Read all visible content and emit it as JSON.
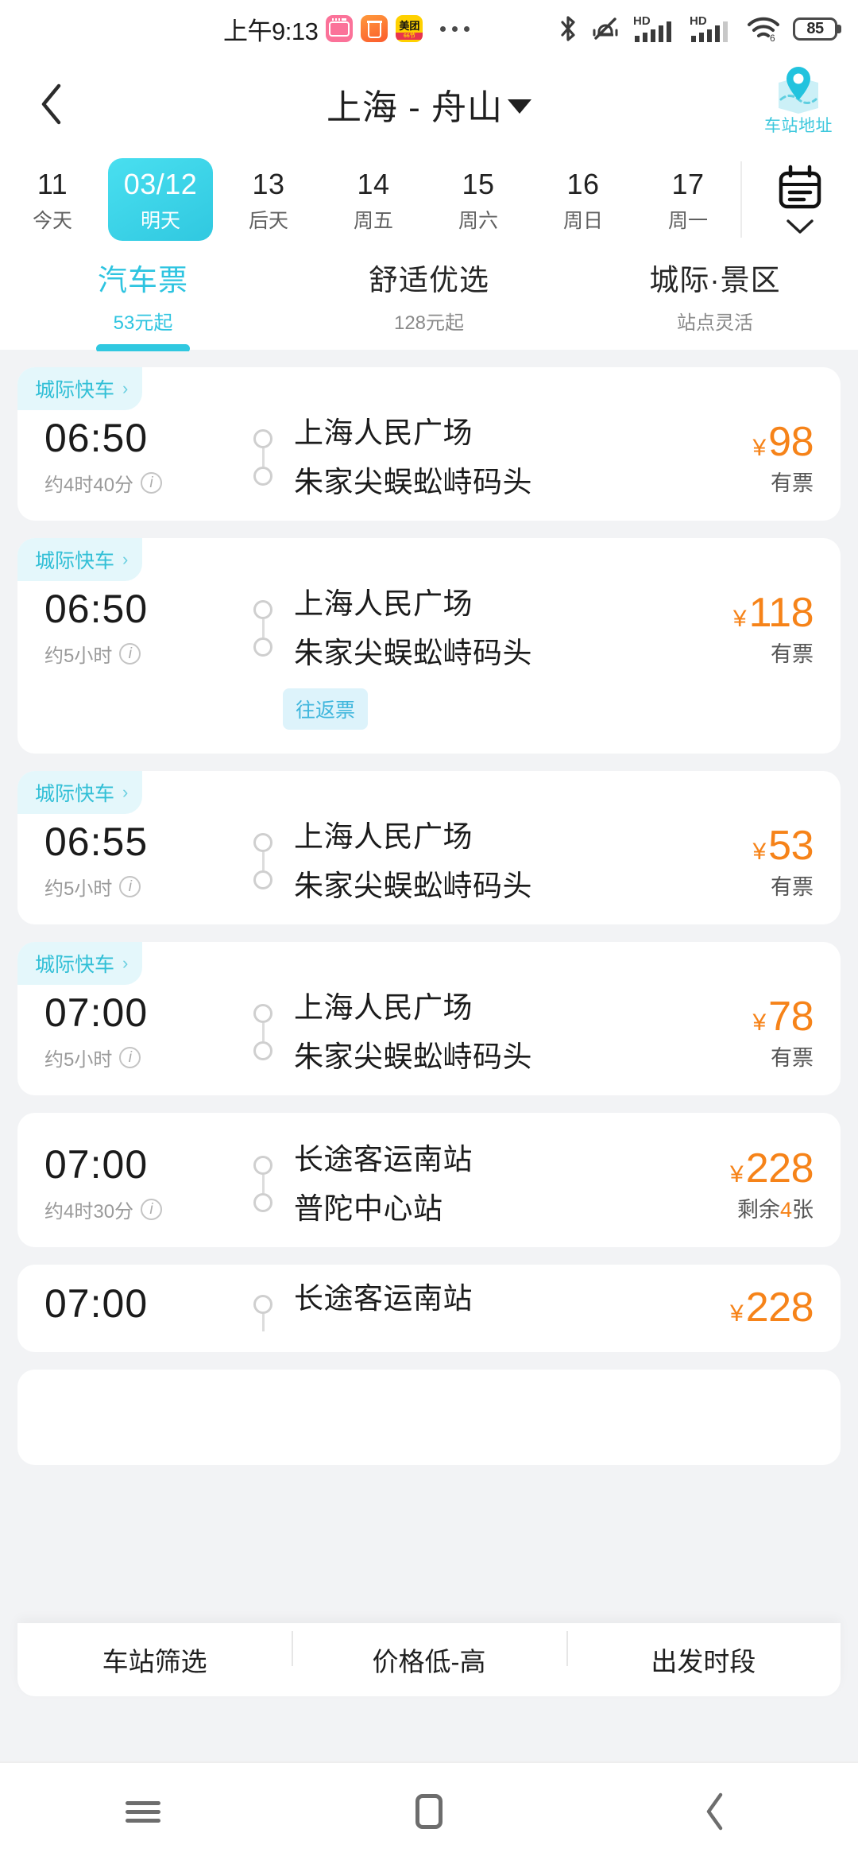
{
  "status_bar": {
    "time": "上午9:13",
    "app_icons": [
      "bilibili-icon",
      "trash-icon",
      "meituan-icon"
    ],
    "meituan_top": "美团",
    "meituan_bottom": "66节",
    "overflow": "more-apps-dots",
    "right_icons": [
      "bluetooth-icon",
      "mute-vibrate-icon",
      "hd-signal-icon-1",
      "hd-signal-icon-2",
      "wifi6-icon"
    ],
    "hd_label": "HD",
    "wifi_label": "6",
    "battery_level": "85"
  },
  "header": {
    "back": "back-chevron",
    "title": "上海 - 舟山",
    "dropdown": "caret-down-icon",
    "map_entry_label": "车站地址"
  },
  "date_bar": {
    "dates": [
      {
        "day": "11",
        "label": "今天",
        "selected": false
      },
      {
        "day": "03/12",
        "label": "明天",
        "selected": true
      },
      {
        "day": "13",
        "label": "后天",
        "selected": false
      },
      {
        "day": "14",
        "label": "周五",
        "selected": false
      },
      {
        "day": "15",
        "label": "周六",
        "selected": false
      },
      {
        "day": "16",
        "label": "周日",
        "selected": false
      },
      {
        "day": "17",
        "label": "周一",
        "selected": false
      }
    ],
    "calendar_icon": "calendar-icon",
    "expand_icon": "chevron-down-icon"
  },
  "tabs": [
    {
      "label": "汽车票",
      "sub": "53元起",
      "active": true
    },
    {
      "label": "舒适优选",
      "sub": "128元起",
      "active": false
    },
    {
      "label": "城际·景区",
      "sub": "站点灵活",
      "active": false
    }
  ],
  "tickets": [
    {
      "badge": "城际快车",
      "badge_chevron": "›",
      "time": "06:50",
      "duration": "约4时40分",
      "from": "上海人民广场",
      "to": "朱家尖蜈蚣峙码头",
      "currency": "¥",
      "price": "98",
      "availability": "有票",
      "round_trip_tag": ""
    },
    {
      "badge": "城际快车",
      "badge_chevron": "›",
      "time": "06:50",
      "duration": "约5小时",
      "from": "上海人民广场",
      "to": "朱家尖蜈蚣峙码头",
      "currency": "¥",
      "price": "118",
      "availability": "有票",
      "round_trip_tag": "往返票"
    },
    {
      "badge": "城际快车",
      "badge_chevron": "›",
      "time": "06:55",
      "duration": "约5小时",
      "from": "上海人民广场",
      "to": "朱家尖蜈蚣峙码头",
      "currency": "¥",
      "price": "53",
      "availability": "有票",
      "round_trip_tag": ""
    },
    {
      "badge": "城际快车",
      "badge_chevron": "›",
      "time": "07:00",
      "duration": "约5小时",
      "from": "上海人民广场",
      "to": "朱家尖蜈蚣峙码头",
      "currency": "¥",
      "price": "78",
      "availability": "有票",
      "round_trip_tag": ""
    },
    {
      "badge": "",
      "badge_chevron": "",
      "time": "07:00",
      "duration": "约4时30分",
      "from": "长途客运南站",
      "to": "普陀中心站",
      "currency": "¥",
      "price": "228",
      "availability_prefix": "剩余",
      "availability_num": "4",
      "availability_suffix": "张",
      "round_trip_tag": ""
    },
    {
      "badge": "",
      "badge_chevron": "",
      "time": "07:00",
      "duration": "",
      "from": "长途客运南站",
      "to": "",
      "currency": "¥",
      "price": "228",
      "availability": "",
      "round_trip_tag": ""
    }
  ],
  "filter_bar": {
    "items": [
      "车站筛选",
      "价格低-高",
      "出发时段"
    ]
  },
  "nav_bar": {
    "items": [
      "menu-icon",
      "home-icon",
      "back-icon"
    ]
  },
  "colors": {
    "accent_cyan": "#30c8e0",
    "price_orange": "#f68319",
    "badge_bg": "#e4f7fb",
    "page_bg": "#f2f3f5"
  }
}
